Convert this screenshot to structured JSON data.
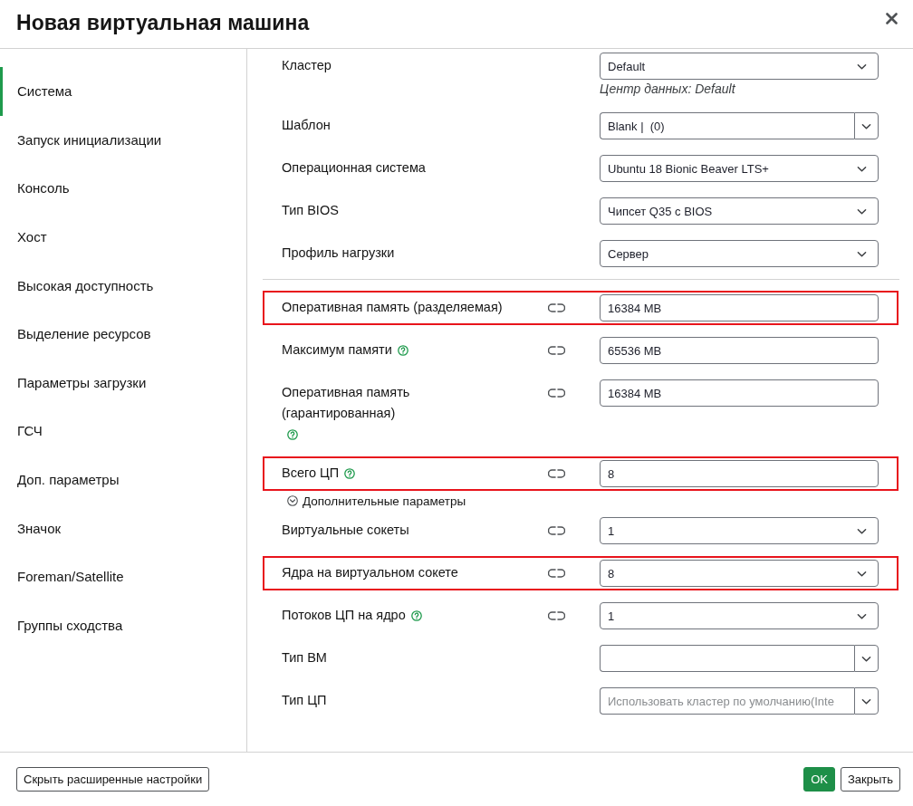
{
  "window": {
    "title": "Новая виртуальная машина"
  },
  "sidebar": {
    "items": [
      {
        "label": "Система",
        "selected": true
      },
      {
        "label": "Запуск инициализации",
        "selected": false
      },
      {
        "label": "Консоль",
        "selected": false
      },
      {
        "label": "Хост",
        "selected": false
      },
      {
        "label": "Высокая доступность",
        "selected": false
      },
      {
        "label": "Выделение ресурсов",
        "selected": false
      },
      {
        "label": "Параметры загрузки",
        "selected": false
      },
      {
        "label": "ГСЧ",
        "selected": false
      },
      {
        "label": "Доп. параметры",
        "selected": false
      },
      {
        "label": "Значок",
        "selected": false
      },
      {
        "label": "Foreman/Satellite",
        "selected": false
      },
      {
        "label": "Группы сходства",
        "selected": false
      }
    ]
  },
  "form": {
    "rows": [
      {
        "kind": "select",
        "label": "Кластер",
        "value": "Default",
        "note": "Центр данных: Default",
        "help": false,
        "linked": false,
        "highlighted": false
      },
      {
        "kind": "combo",
        "label": "Шаблон",
        "value": "Blank |  (0)",
        "help": false,
        "linked": false,
        "highlighted": false
      },
      {
        "kind": "select",
        "label": "Операционная система",
        "value": "Ubuntu 18 Bionic Beaver LTS+",
        "help": false,
        "linked": false,
        "highlighted": false
      },
      {
        "kind": "select",
        "label": "Тип BIOS",
        "value": "Чипсет Q35 с BIOS",
        "help": false,
        "linked": false,
        "highlighted": false
      },
      {
        "kind": "select",
        "label": "Профиль нагрузки",
        "value": "Сервер",
        "help": false,
        "linked": false,
        "highlighted": false
      },
      {
        "kind": "divider"
      },
      {
        "kind": "text",
        "label": "Оперативная память (разделяемая)",
        "value": "16384 MB",
        "help": false,
        "linked": true,
        "highlighted": true
      },
      {
        "kind": "text",
        "label": "Максимум памяти",
        "value": "65536 MB",
        "help": true,
        "linked": true,
        "highlighted": false
      },
      {
        "kind": "text",
        "label": "Оперативная память (гарантированная)",
        "value": "16384 MB",
        "help": true,
        "linked": true,
        "highlighted": false
      },
      {
        "kind": "text",
        "label": "Всего ЦП",
        "value": "8",
        "help": true,
        "linked": true,
        "highlighted": true
      },
      {
        "kind": "toggle",
        "label": "Дополнительные параметры",
        "expanded": true
      },
      {
        "kind": "select",
        "label": "Виртуальные сокеты",
        "value": "1",
        "help": false,
        "linked": true,
        "highlighted": false
      },
      {
        "kind": "select",
        "label": "Ядра на виртуальном сокете",
        "value": "8",
        "help": false,
        "linked": true,
        "highlighted": true
      },
      {
        "kind": "select",
        "label": "Потоков ЦП на ядро",
        "value": "1",
        "help": true,
        "linked": true,
        "highlighted": false
      },
      {
        "kind": "combo",
        "label": "Тип ВМ",
        "help": false,
        "linked": false,
        "highlighted": false
      },
      {
        "kind": "combo",
        "label": "Тип ЦП",
        "placeholder": "Использовать кластер по умолчанию(Inte",
        "help": false,
        "linked": false,
        "highlighted": false
      }
    ]
  },
  "footer": {
    "left_button": "Скрыть расширенные настройки",
    "buttons": [
      {
        "label": "OK",
        "kind": "primary"
      },
      {
        "label": "Закрыть",
        "kind": "secondary"
      }
    ]
  }
}
